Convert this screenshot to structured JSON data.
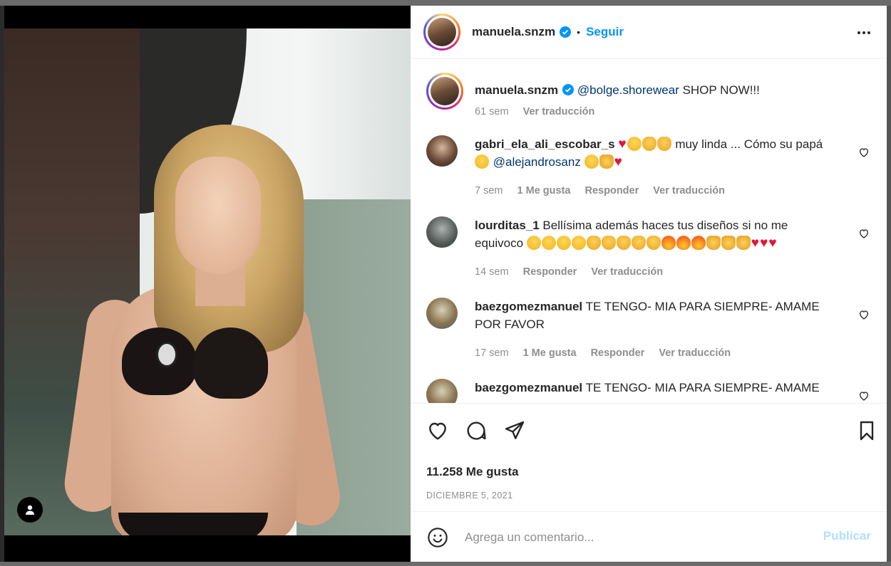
{
  "post": {
    "author": "manuela.snzm",
    "separator": "•",
    "follow_label": "Seguir",
    "caption": {
      "mention": "@bolge.shorewear",
      "text": " SHOP NOW!!!",
      "age": "61 sem",
      "translate": "Ver traducción"
    },
    "likes": "11.258 Me gusta",
    "date": "DICIEMBRE 5, 2021"
  },
  "comments": [
    {
      "user": "gabri_ela_ali_escobar_s",
      "text_a": " muy linda ... Cómo su papá ",
      "mention": "@alejandrosanz",
      "age": "7 sem",
      "likes": "1 Me gusta",
      "reply": "Responder",
      "translate": "Ver traducción"
    },
    {
      "user": "lourditas_1",
      "text_a": " Bellísima además haces tus diseños si no me equivoco ",
      "age": "14 sem",
      "reply": "Responder",
      "translate": "Ver traducción"
    },
    {
      "user": "baezgomezmanuel",
      "text_a": " TE TENGO- MIA PARA SIEMPRE- AMAME POR FAVOR",
      "age": "17 sem",
      "likes": "1 Me gusta",
      "reply": "Responder",
      "translate": "Ver traducción"
    },
    {
      "user": "baezgomezmanuel",
      "text_a": " TE TENGO- MIA PARA SIEMPRE- AMAME"
    }
  ],
  "compose": {
    "placeholder": "Agrega un comentario...",
    "publish_label": "Publicar"
  },
  "icons": {
    "like": "heart-icon",
    "comment": "comment-icon",
    "share": "send-icon",
    "save": "bookmark-icon",
    "emoji": "smiley-icon",
    "more": "more-horizontal-icon",
    "verified": "verified-badge-icon",
    "tagged": "user-tag-icon"
  },
  "colors": {
    "link_blue": "#0095f6",
    "mention": "#00376b",
    "publish_disabled": "#b2dffc",
    "secondary_text": "#8e8e8e"
  }
}
